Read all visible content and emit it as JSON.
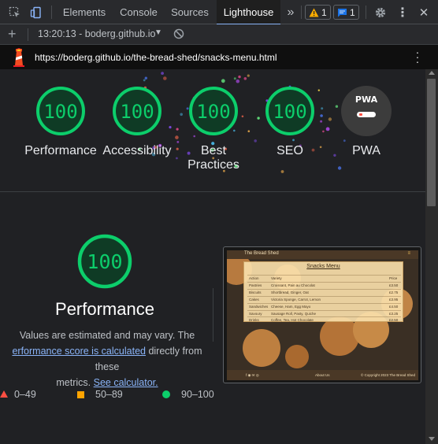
{
  "devtools": {
    "tabs": [
      {
        "label": "Elements"
      },
      {
        "label": "Console"
      },
      {
        "label": "Sources"
      },
      {
        "label": "Lighthouse"
      }
    ],
    "overflow_icon": "double-chevron-right-icon",
    "warnings_count": "1",
    "messages_count": "1",
    "accent_color": "#8ab4f8"
  },
  "report_toolbar": {
    "report_label": "13:20:13 - boderg.github.io"
  },
  "urlbar": {
    "url": "https://boderg.github.io/the-bread-shed/snacks-menu.html"
  },
  "gauges": [
    {
      "score": "100",
      "label": "Performance"
    },
    {
      "score": "100",
      "label": "Accessibility"
    },
    {
      "score": "100",
      "label": "Best Practices"
    },
    {
      "score": "100",
      "label": "SEO"
    }
  ],
  "pwa": {
    "badge": "PWA",
    "label": "PWA"
  },
  "performance": {
    "score": "100",
    "title": "Performance",
    "desc_1": "Values are estimated and may vary. The",
    "desc_link_1": "erformance score is calculated",
    "desc_2": " directly from these",
    "desc_3": "metrics. ",
    "desc_link_2": "See calculator."
  },
  "legend": [
    {
      "range": "0–49",
      "color": "#ff4e42"
    },
    {
      "range": "50–89",
      "color": "#ffa400"
    },
    {
      "range": "90–100",
      "color": "#0cce6b"
    }
  ],
  "screenshot": {
    "nav_title": "The Bread Shed",
    "nav_menu": "≡",
    "card_title": "Snacks Menu",
    "rows": [
      [
        "Action",
        "Variety",
        "Price"
      ],
      [
        "Pastries",
        "Croissant, Pain au Chocolat",
        "£3.50"
      ],
      [
        "Biscuits",
        "Shortbread, Ginger, Oat",
        "£2.75"
      ],
      [
        "Cakes",
        "Victoria Sponge, Carrot, Lemon",
        "£3.95"
      ],
      [
        "Sandwiches",
        "Cheese, Ham, Egg Mayo",
        "£4.50"
      ],
      [
        "Savoury",
        "Sausage Roll, Pasty, Quiche",
        "£3.25"
      ],
      [
        "Drinks",
        "Coffee, Tea, Hot Chocolate",
        "£2.50"
      ]
    ],
    "footer_social": "f  ◉  ✉  ◎",
    "footer_mid": "About Us",
    "footer_right": "© Copyright 2023 The Bread Shed"
  },
  "colors": {
    "pass": "#0cce6b",
    "pass_bg": "#0f3b25",
    "panel": "#202124"
  }
}
